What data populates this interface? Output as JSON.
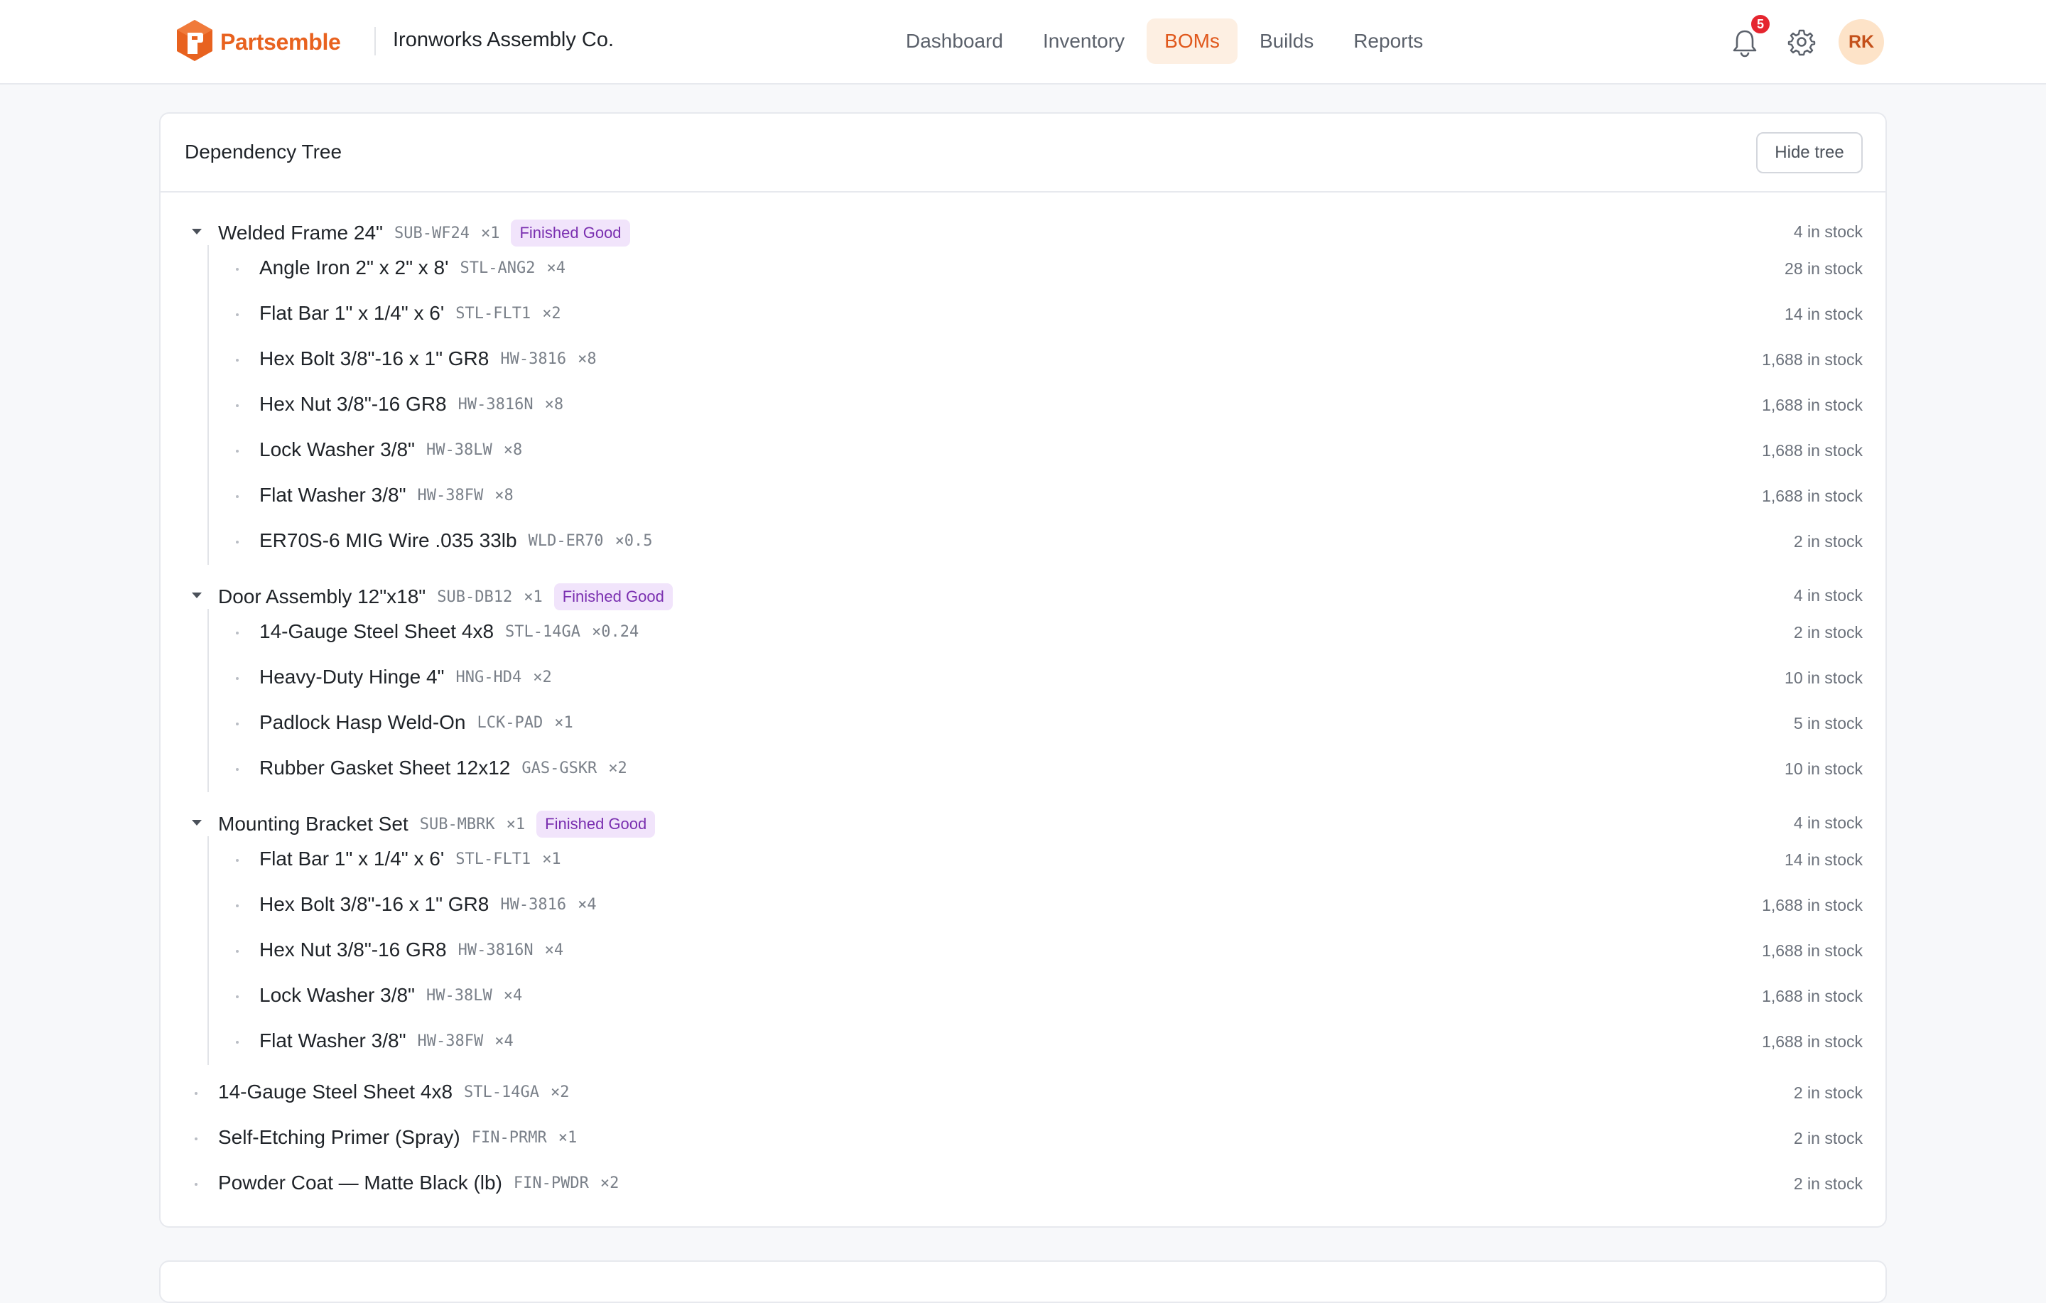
{
  "brand": {
    "name": "Partsemble",
    "accent": "#e8621f"
  },
  "org": {
    "name": "Ironworks Assembly Co."
  },
  "nav": {
    "items": [
      {
        "label": "Dashboard",
        "active": false
      },
      {
        "label": "Inventory",
        "active": false
      },
      {
        "label": "BOMs",
        "active": true
      },
      {
        "label": "Builds",
        "active": false
      },
      {
        "label": "Reports",
        "active": false
      }
    ]
  },
  "header_actions": {
    "bell_icon": "bell-icon",
    "notification_count": "5",
    "settings_icon": "gear-icon",
    "avatar_initials": "RK"
  },
  "tree_card": {
    "title": "Dependency Tree",
    "hide_label": "Hide tree",
    "groups": [
      {
        "name": "Welded Frame 24\"",
        "sku": "SUB-WF24",
        "qty": "×1",
        "badge": "Finished Good",
        "stock": "4 in stock",
        "children": [
          {
            "name": "Angle Iron 2\" x 2\" x 8'",
            "sku": "STL-ANG2",
            "qty": "×4",
            "stock": "28 in stock"
          },
          {
            "name": "Flat Bar 1\" x 1/4\" x 6'",
            "sku": "STL-FLT1",
            "qty": "×2",
            "stock": "14 in stock"
          },
          {
            "name": "Hex Bolt 3/8\"-16 x 1\" GR8",
            "sku": "HW-3816",
            "qty": "×8",
            "stock": "1,688 in stock"
          },
          {
            "name": "Hex Nut 3/8\"-16 GR8",
            "sku": "HW-3816N",
            "qty": "×8",
            "stock": "1,688 in stock"
          },
          {
            "name": "Lock Washer 3/8\"",
            "sku": "HW-38LW",
            "qty": "×8",
            "stock": "1,688 in stock"
          },
          {
            "name": "Flat Washer 3/8\"",
            "sku": "HW-38FW",
            "qty": "×8",
            "stock": "1,688 in stock"
          },
          {
            "name": "ER70S-6 MIG Wire .035 33lb",
            "sku": "WLD-ER70",
            "qty": "×0.5",
            "stock": "2 in stock"
          }
        ]
      },
      {
        "name": "Door Assembly 12\"x18\"",
        "sku": "SUB-DB12",
        "qty": "×1",
        "badge": "Finished Good",
        "stock": "4 in stock",
        "children": [
          {
            "name": "14-Gauge Steel Sheet 4x8",
            "sku": "STL-14GA",
            "qty": "×0.24",
            "stock": "2 in stock"
          },
          {
            "name": "Heavy-Duty Hinge 4\"",
            "sku": "HNG-HD4",
            "qty": "×2",
            "stock": "10 in stock"
          },
          {
            "name": "Padlock Hasp Weld-On",
            "sku": "LCK-PAD",
            "qty": "×1",
            "stock": "5 in stock"
          },
          {
            "name": "Rubber Gasket Sheet 12x12",
            "sku": "GAS-GSKR",
            "qty": "×2",
            "stock": "10 in stock"
          }
        ]
      },
      {
        "name": "Mounting Bracket Set",
        "sku": "SUB-MBRK",
        "qty": "×1",
        "badge": "Finished Good",
        "stock": "4 in stock",
        "children": [
          {
            "name": "Flat Bar 1\" x 1/4\" x 6'",
            "sku": "STL-FLT1",
            "qty": "×1",
            "stock": "14 in stock"
          },
          {
            "name": "Hex Bolt 3/8\"-16 x 1\" GR8",
            "sku": "HW-3816",
            "qty": "×4",
            "stock": "1,688 in stock"
          },
          {
            "name": "Hex Nut 3/8\"-16 GR8",
            "sku": "HW-3816N",
            "qty": "×4",
            "stock": "1,688 in stock"
          },
          {
            "name": "Lock Washer 3/8\"",
            "sku": "HW-38LW",
            "qty": "×4",
            "stock": "1,688 in stock"
          },
          {
            "name": "Flat Washer 3/8\"",
            "sku": "HW-38FW",
            "qty": "×4",
            "stock": "1,688 in stock"
          }
        ]
      }
    ],
    "leaves": [
      {
        "name": "14-Gauge Steel Sheet 4x8",
        "sku": "STL-14GA",
        "qty": "×2",
        "stock": "2 in stock"
      },
      {
        "name": "Self-Etching Primer (Spray)",
        "sku": "FIN-PRMR",
        "qty": "×1",
        "stock": "2 in stock"
      },
      {
        "name": "Powder Coat — Matte Black (lb)",
        "sku": "FIN-PWDR",
        "qty": "×2",
        "stock": "2 in stock"
      }
    ]
  }
}
